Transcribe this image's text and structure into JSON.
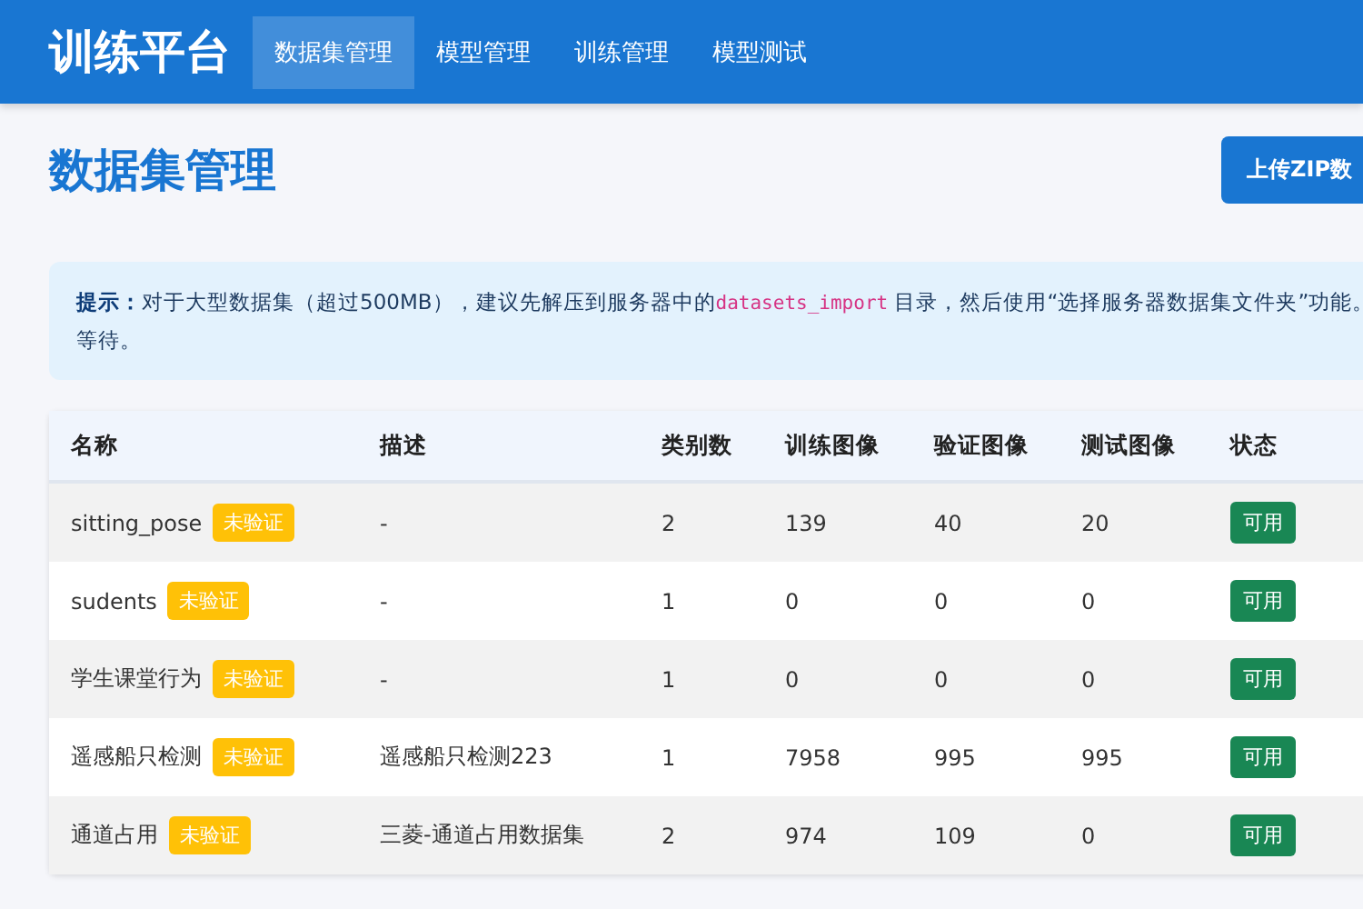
{
  "app": {
    "title": "训练平台"
  },
  "nav": [
    {
      "label": "数据集管理",
      "selected": true
    },
    {
      "label": "模型管理",
      "selected": false
    },
    {
      "label": "训练管理",
      "selected": false
    },
    {
      "label": "模型测试",
      "selected": false
    }
  ],
  "page": {
    "title": "数据集管理",
    "upload_button": "上传ZIP数"
  },
  "hint": {
    "label": "提示：",
    "text_before": "对于大型数据集（超过500MB），建议先解压到服务器中的",
    "code": "datasets_import",
    "text_after": " 目录，然后使用“选择服务器数据集文件夹”功能。",
    "text_line2": "等待。"
  },
  "table": {
    "columns": [
      "名称",
      "描述",
      "类别数",
      "训练图像",
      "验证图像",
      "测试图像",
      "状态"
    ],
    "rows": [
      {
        "name": "sitting_pose",
        "badge": "未验证",
        "description": "-",
        "classes": "2",
        "train": "139",
        "val": "40",
        "test": "20",
        "status": "可用"
      },
      {
        "name": "sudents",
        "badge": "未验证",
        "description": "-",
        "classes": "1",
        "train": "0",
        "val": "0",
        "test": "0",
        "status": "可用"
      },
      {
        "name": "学生课堂行为",
        "badge": "未验证",
        "description": "-",
        "classes": "1",
        "train": "0",
        "val": "0",
        "test": "0",
        "status": "可用"
      },
      {
        "name": "遥感船只检测",
        "badge": "未验证",
        "description": "遥感船只检测223",
        "classes": "1",
        "train": "7958",
        "val": "995",
        "test": "995",
        "status": "可用"
      },
      {
        "name": "通道占用",
        "badge": "未验证",
        "description": "三菱-通道占用数据集",
        "classes": "2",
        "train": "974",
        "val": "109",
        "test": "0",
        "status": "可用"
      }
    ]
  }
}
